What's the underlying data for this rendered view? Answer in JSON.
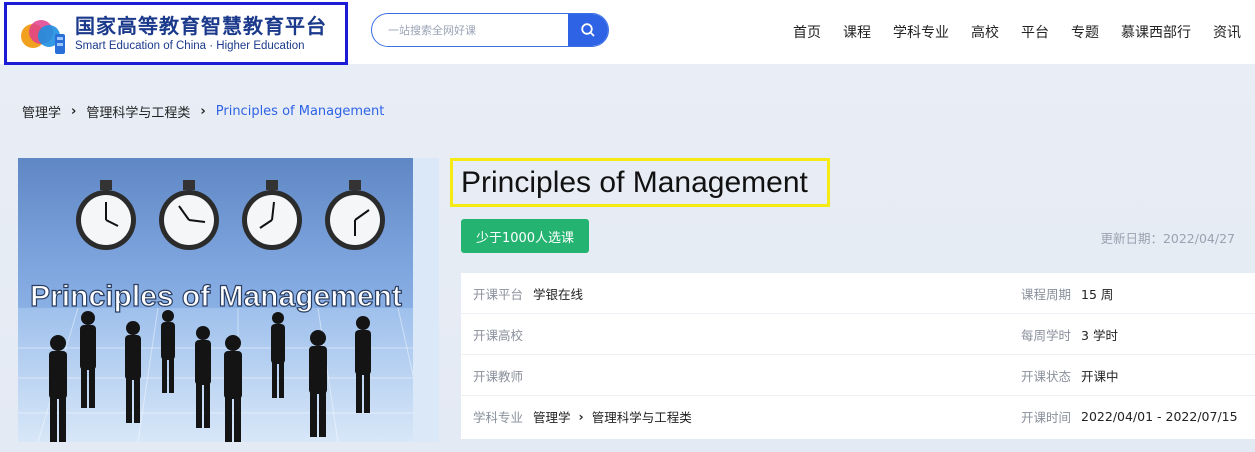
{
  "header": {
    "logo_cn": "国家高等教育智慧教育平台",
    "logo_en": "Smart Education of China · Higher Education",
    "search_placeholder": "一站搜索全网好课",
    "nav": [
      "首页",
      "课程",
      "学科专业",
      "高校",
      "平台",
      "专题",
      "慕课西部行",
      "资讯"
    ]
  },
  "breadcrumb": {
    "items": [
      "管理学",
      "管理科学与工程类"
    ],
    "current": "Principles of Management"
  },
  "cover": {
    "text": "Principles of Management"
  },
  "course": {
    "title": "Principles of Management",
    "enroll_button": "少于1000人选课",
    "update_date": "更新日期：2022/04/27"
  },
  "info": {
    "platform_label": "开课平台",
    "platform_value": "学银在线",
    "university_label": "开课高校",
    "university_value": "",
    "teacher_label": "开课教师",
    "teacher_value": "",
    "subject_label": "学科专业",
    "subject_value_1": "管理学",
    "subject_value_2": "管理科学与工程类",
    "duration_label": "课程周期",
    "duration_value": "15 周",
    "hours_label": "每周学时",
    "hours_value": "3 学时",
    "status_label": "开课状态",
    "status_value": "开课中",
    "time_label": "开课时间",
    "time_value": "2022/04/01 - 2022/07/15"
  },
  "colors": {
    "accent": "#2f63e6",
    "enroll": "#25b371",
    "logo_border": "#1c1cd6",
    "title_border": "#f5ea12"
  }
}
